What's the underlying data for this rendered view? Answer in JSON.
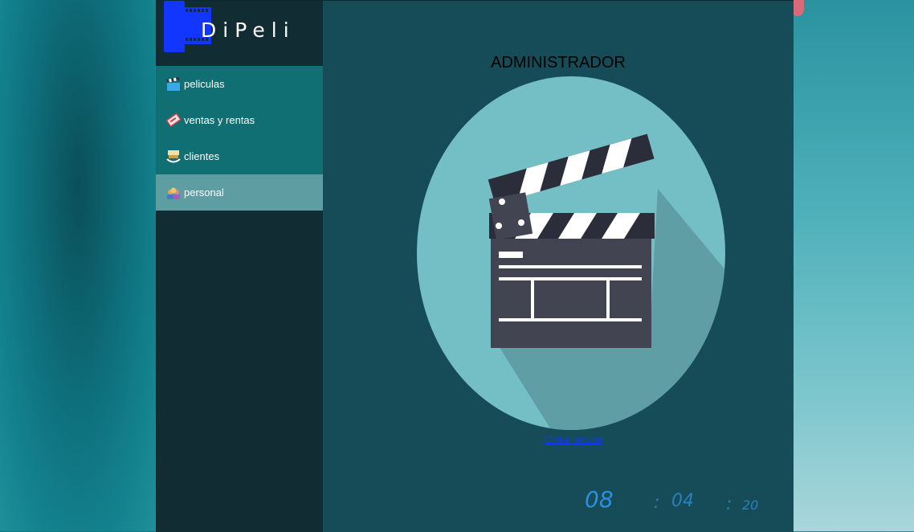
{
  "app": {
    "logo_text": "DiPeli"
  },
  "sidebar": {
    "items": [
      {
        "label": "peliculas",
        "icon": "clapperboard-icon"
      },
      {
        "label": "ventas y rentas",
        "icon": "ticket-icon"
      },
      {
        "label": "clientes",
        "icon": "popcorn-icon"
      },
      {
        "label": "personal",
        "icon": "people-icon",
        "active": true
      }
    ]
  },
  "main": {
    "title": "ADMINISTRADOR",
    "logout_label": "Cerrar sesion",
    "hero_icon": "clapperboard-icon"
  },
  "clock": {
    "hours": "08",
    "sep": ":",
    "minutes": "04",
    "seconds": "20"
  },
  "colors": {
    "sidebar_bg": "#112d33",
    "menu_bg": "#0f6f73",
    "menu_active": "#5e9ea3",
    "main_bg": "#154c57",
    "circle": "#74bec5",
    "logo_blue": "#1336ff",
    "link": "#1238ff",
    "clock": "#2b8fe0"
  }
}
